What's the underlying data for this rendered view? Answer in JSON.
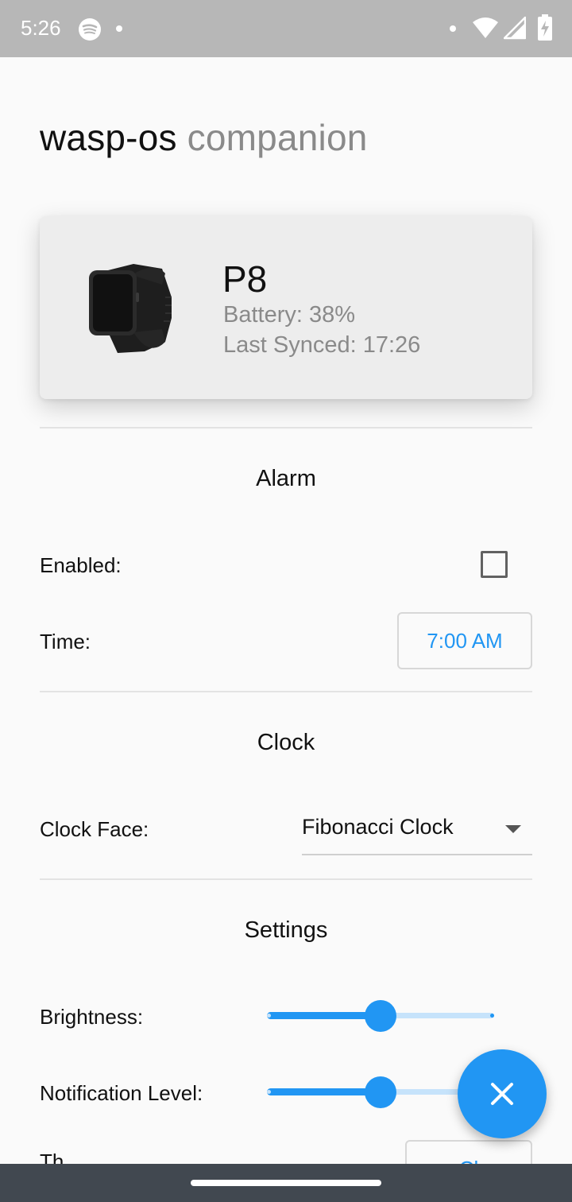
{
  "status_bar": {
    "time": "5:26",
    "left_icon": "spotify-icon",
    "right_icons": [
      "wifi-icon",
      "signal-icon",
      "battery-charging-icon"
    ]
  },
  "app_title": {
    "part1": "wasp-os",
    "part2": "companion"
  },
  "device": {
    "name": "P8",
    "battery": "Battery: 38%",
    "last_synced": "Last Synced: 17:26",
    "image": "smartwatch-image"
  },
  "alarm": {
    "heading": "Alarm",
    "enabled_label": "Enabled:",
    "enabled": false,
    "time_label": "Time:",
    "time_value": "7:00 AM"
  },
  "clock": {
    "heading": "Clock",
    "face_label": "Clock Face:",
    "face_value": "Fibonacci Clock"
  },
  "settings": {
    "heading": "Settings",
    "brightness_label": "Brightness:",
    "brightness_value": 0.5,
    "notification_label": "Notification Level:",
    "notification_value": 0.5,
    "partial_label": "Th",
    "partial_button": "Cl"
  },
  "fab": {
    "icon": "close-icon"
  },
  "colors": {
    "accent": "#2196f3",
    "accent_light": "#c6e3fb",
    "status_bar": "#b7b7b7",
    "nav_bar": "#414850",
    "secondary_text": "#8a8a8a"
  }
}
